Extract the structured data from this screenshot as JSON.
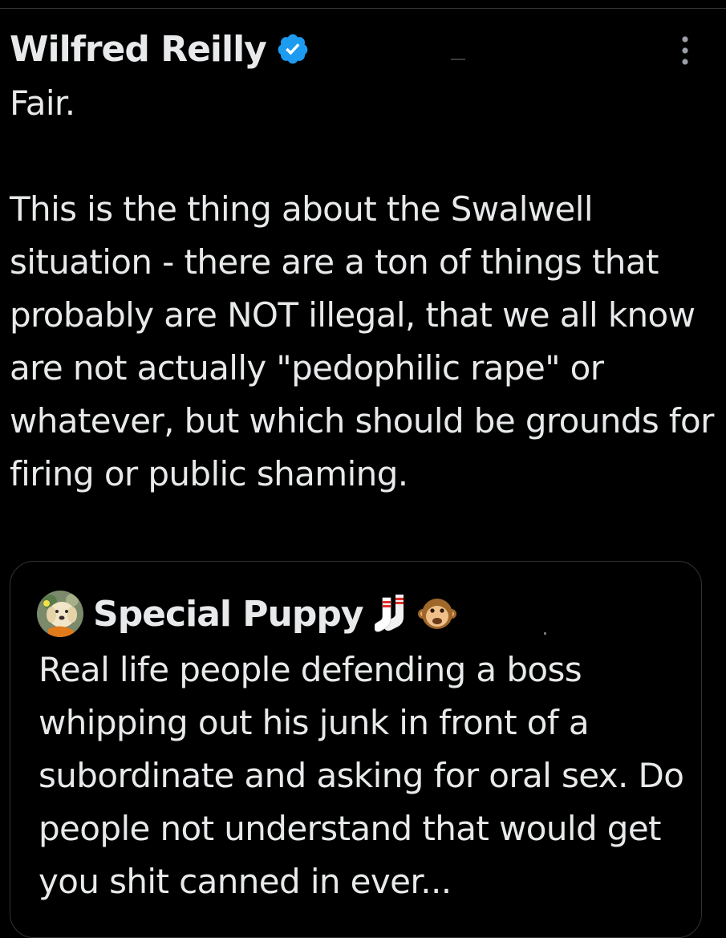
{
  "tweet": {
    "author": "Wilfred Reilly",
    "verified_icon": "verified-badge-icon",
    "more_icon": "more-options-icon",
    "text": "Fair.\n\nThis is the thing about the Swalwell situation - there are a ton of things that probably are NOT illegal, that we all know are not actually \"pedophilic rape\" or whatever, but which should be grounds for firing or public shaming."
  },
  "quote": {
    "author": "Special Puppy",
    "avatar_icon": "dog-avatar",
    "name_emojis": [
      "socks-emoji",
      "monkey-face-emoji"
    ],
    "text": "Real life people defending a boss whipping out his junk in front of a subordinate and asking for oral sex. Do people not understand that would get you shit canned in ever..."
  },
  "colors": {
    "background": "#000000",
    "text": "#e7e9ea",
    "border": "#2f3336",
    "verified": "#1d9bf0",
    "muted": "#71767b"
  }
}
